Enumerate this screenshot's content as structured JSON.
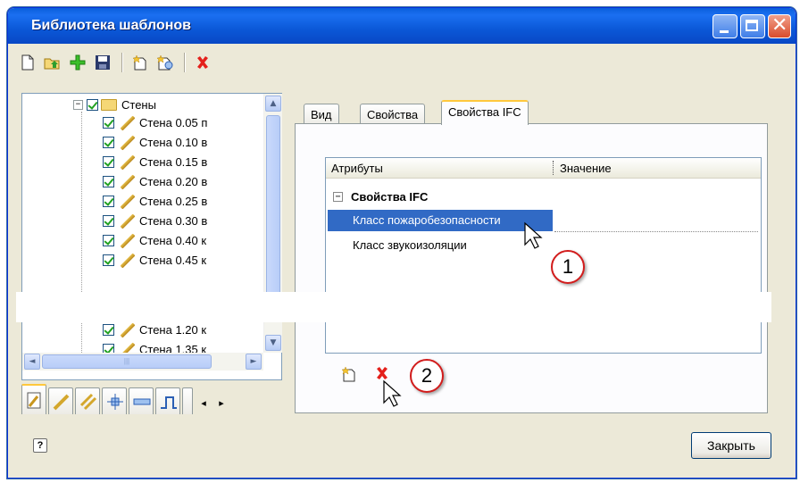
{
  "window": {
    "title": "Библиотека шаблонов",
    "minimize_icon": "minimize-icon",
    "maximize_icon": "maximize-icon",
    "close_icon": "close-icon"
  },
  "toolbar": {
    "items": [
      {
        "name": "new-icon",
        "glyph": "🗋"
      },
      {
        "name": "open-icon",
        "glyph": "📂"
      },
      {
        "name": "add-icon",
        "glyph": "+"
      },
      {
        "name": "save-icon",
        "glyph": "💾"
      },
      {
        "name": "new-template-icon",
        "glyph": "✦"
      },
      {
        "name": "template-settings-icon",
        "glyph": "✧"
      },
      {
        "name": "delete-icon",
        "glyph": "✕"
      }
    ]
  },
  "tree": {
    "root": {
      "label": "Стены",
      "expander": "−"
    },
    "items": [
      "Стена 0.05 п",
      "Стена 0.10 в",
      "Стена 0.15 в",
      "Стена 0.20 в",
      "Стена 0.25 в",
      "Стена 0.30 в",
      "Стена 0.40 к",
      "Стена 0.45 к",
      "Стена 1.20 к",
      "Стена 1.35 к"
    ],
    "scroll_up": "▲",
    "scroll_down": "▼",
    "scroll_left": "◄",
    "scroll_right": "►"
  },
  "tabs": {
    "view": "Вид",
    "properties": "Свойства",
    "ifc": "Свойства IFC"
  },
  "grid": {
    "col_attr": "Атрибуты",
    "col_value": "Значение",
    "group": "Свойства IFC",
    "group_expander": "−",
    "rows": [
      {
        "label": "Класс пожаробезопасности",
        "value": ""
      },
      {
        "label": "Класс звукоизоляции",
        "value": ""
      }
    ]
  },
  "annotations": {
    "first": "1",
    "second": "2"
  },
  "buttons": {
    "close": "Закрыть",
    "help": "?"
  },
  "colors": {
    "title_bar": "#0a5fdb",
    "selection": "#316ac5",
    "tab_highlight": "#ffc83c",
    "badge_border": "#d21c1c",
    "window_bg": "#ece9d8"
  }
}
